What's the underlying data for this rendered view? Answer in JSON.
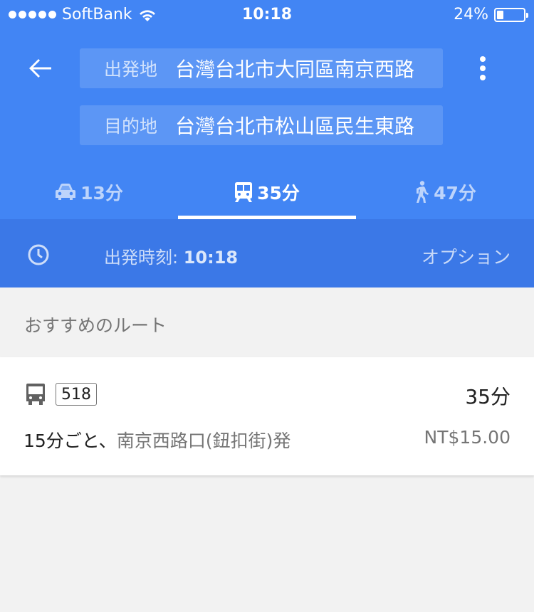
{
  "status_bar": {
    "carrier": "SoftBank",
    "time": "10:18",
    "battery": "24%",
    "battery_level": 0.24
  },
  "directions": {
    "origin_label": "出発地",
    "origin_value": "台灣台北市大同區南京西路",
    "destination_label": "目的地",
    "destination_value": "台灣台北市松山區民生東路"
  },
  "modes": [
    {
      "name": "car-icon",
      "time": "13分"
    },
    {
      "name": "transit-icon",
      "time": "35分"
    },
    {
      "name": "walk-icon",
      "time": "47分"
    }
  ],
  "time_bar": {
    "depart_label": "出発時刻:",
    "depart_time": "10:18",
    "options_label": "オプション"
  },
  "section_title": "おすすめのルート",
  "route": {
    "route_number": "518",
    "duration": "35分",
    "frequency": "15分ごと、",
    "departure_stop": "南京西路口(鈕扣街)発",
    "fare": "NT$15.00"
  },
  "colors": {
    "primary": "#4285f4",
    "time_bar": "#3b78e7",
    "background": "#f2f2f2"
  }
}
